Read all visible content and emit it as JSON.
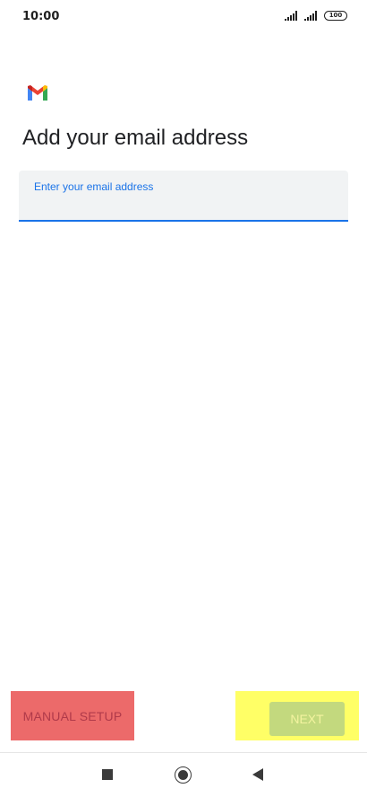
{
  "status_bar": {
    "time": "10:00",
    "battery": "100"
  },
  "header": {
    "logo_icon": "gmail-logo",
    "title": "Add your email address"
  },
  "email_field": {
    "label": "Enter your email address",
    "value": ""
  },
  "actions": {
    "manual_setup_label": "MANUAL SETUP",
    "next_label": "NEXT"
  },
  "colors": {
    "accent": "#1a73e8",
    "manual_setup_bg": "#ec6a6a",
    "next_highlight_bg": "#ffff66",
    "next_button_bg": "#c3d97e"
  },
  "nav_bar": {
    "icons": [
      "recent-apps-icon",
      "home-icon",
      "back-icon"
    ]
  }
}
